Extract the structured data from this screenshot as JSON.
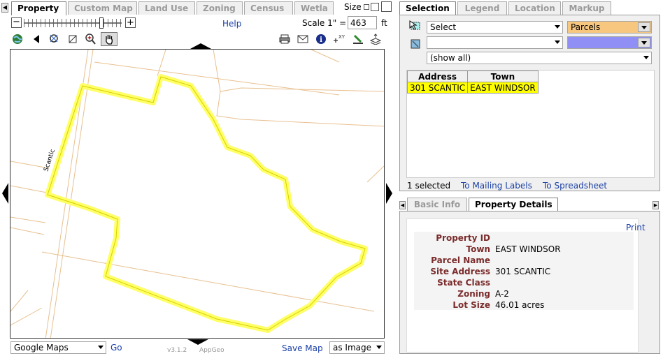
{
  "left_tabs": [
    "Property",
    "Custom Map",
    "Land Use",
    "Zoning",
    "Census",
    "Wetla"
  ],
  "size_label": "Size",
  "help_label": "Help",
  "scale": {
    "label": "Scale 1\" =",
    "value": "463",
    "unit": "ft"
  },
  "map": {
    "street_label": "Scantic"
  },
  "basemap": {
    "selected": "Google Maps",
    "go_label": "Go"
  },
  "footer": {
    "version": "v3.1.2",
    "brand": "AppGeo",
    "save_map_label": "Save Map",
    "save_format": "as Image"
  },
  "right_tabs": [
    "Selection",
    "Legend",
    "Location",
    "Markup"
  ],
  "selection": {
    "mode": "Select",
    "layer": "Parcels",
    "layer_color": "#f7c77f",
    "second_layer_color": "#8f8ff6",
    "filter": "(show all)",
    "table_headers": [
      "Address",
      "Town"
    ],
    "rows": [
      [
        "301 SCANTIC",
        "EAST WINDSOR"
      ]
    ],
    "selected_count": "1 selected",
    "mailing_labels": "To Mailing Labels",
    "spreadsheet": "To Spreadsheet"
  },
  "info_tabs": [
    "Basic Info",
    "Property Details"
  ],
  "details": {
    "print_label": "Print",
    "fields": [
      {
        "label": "Property ID",
        "value": ""
      },
      {
        "label": "Town",
        "value": "EAST WINDSOR"
      },
      {
        "label": "Parcel Name",
        "value": ""
      },
      {
        "label": "Site Address",
        "value": "301 SCANTIC"
      },
      {
        "label": "State Class",
        "value": ""
      },
      {
        "label": "Zoning",
        "value": "A-2"
      },
      {
        "label": "Lot Size",
        "value": "46.01 acres"
      }
    ]
  },
  "colors": {
    "highlight": "#ffff00",
    "parcel_lines": "#e8b884",
    "row_highlight": "#ffff00"
  }
}
